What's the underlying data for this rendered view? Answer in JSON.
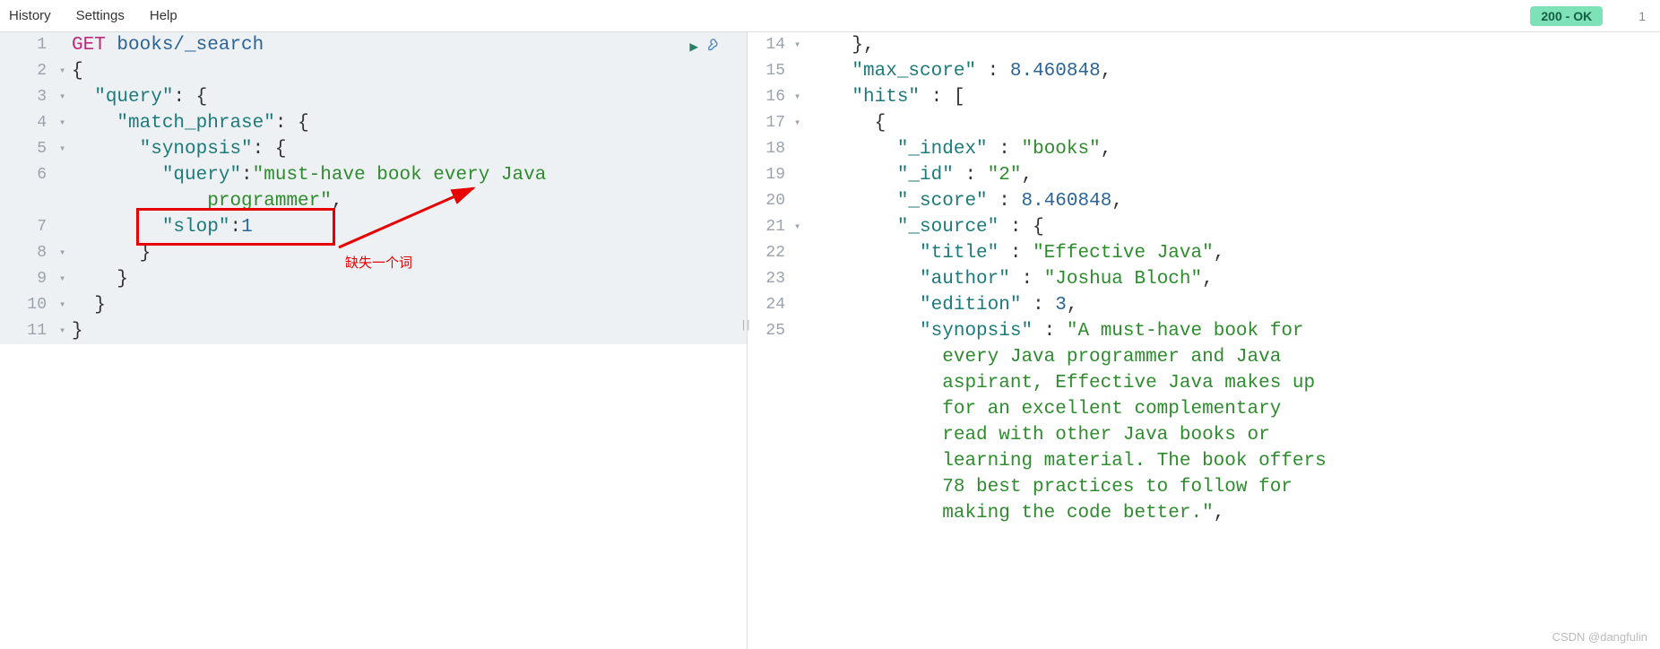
{
  "menubar": {
    "history": "History",
    "settings": "Settings",
    "help": "Help",
    "status": "200 - OK",
    "status_extra": "1"
  },
  "request": {
    "method": "GET",
    "path": "books/_search",
    "lines": {
      "l1_open": "{",
      "l2_query": "\"query\"",
      "l3_mp": "\"match_phrase\"",
      "l4_syn": "\"synopsis\"",
      "l5_qkey": "\"query\"",
      "l5_qval": "\"must-have book every Java",
      "l5_cont": "programmer\"",
      "l6_slop": "\"slop\"",
      "l6_slopv": "1"
    },
    "gutter": [
      "1",
      "2",
      "3",
      "4",
      "5",
      "6",
      "7",
      "8",
      "9",
      "10",
      "11"
    ]
  },
  "annotation": {
    "missing_word": "缺失一个词"
  },
  "response": {
    "gutter": [
      "14",
      "15",
      "16",
      "17",
      "18",
      "19",
      "20",
      "21",
      "22",
      "23",
      "24",
      "25"
    ],
    "max_score_key": "\"max_score\"",
    "max_score_val": "8.460848",
    "hits_key": "\"hits\"",
    "index_key": "\"_index\"",
    "index_val": "\"books\"",
    "id_key": "\"_id\"",
    "id_val": "\"2\"",
    "score_key": "\"_score\"",
    "score_val": "8.460848",
    "source_key": "\"_source\"",
    "title_key": "\"title\"",
    "title_val": "\"Effective Java\"",
    "author_key": "\"author\"",
    "author_val": "\"Joshua Bloch\"",
    "edition_key": "\"edition\"",
    "edition_val": "3",
    "synopsis_key": "\"synopsis\"",
    "synopsis_l1": "\"A must-have book for",
    "synopsis_l2": "every Java programmer and Java",
    "synopsis_l3": "aspirant, Effective Java makes up",
    "synopsis_l4": "for an excellent complementary",
    "synopsis_l5": "read with other Java books or",
    "synopsis_l6": "learning material. The book offers",
    "synopsis_l7": "78 best practices to follow for",
    "synopsis_l8": "making the code better.\""
  },
  "watermark": "CSDN @dangfulin"
}
